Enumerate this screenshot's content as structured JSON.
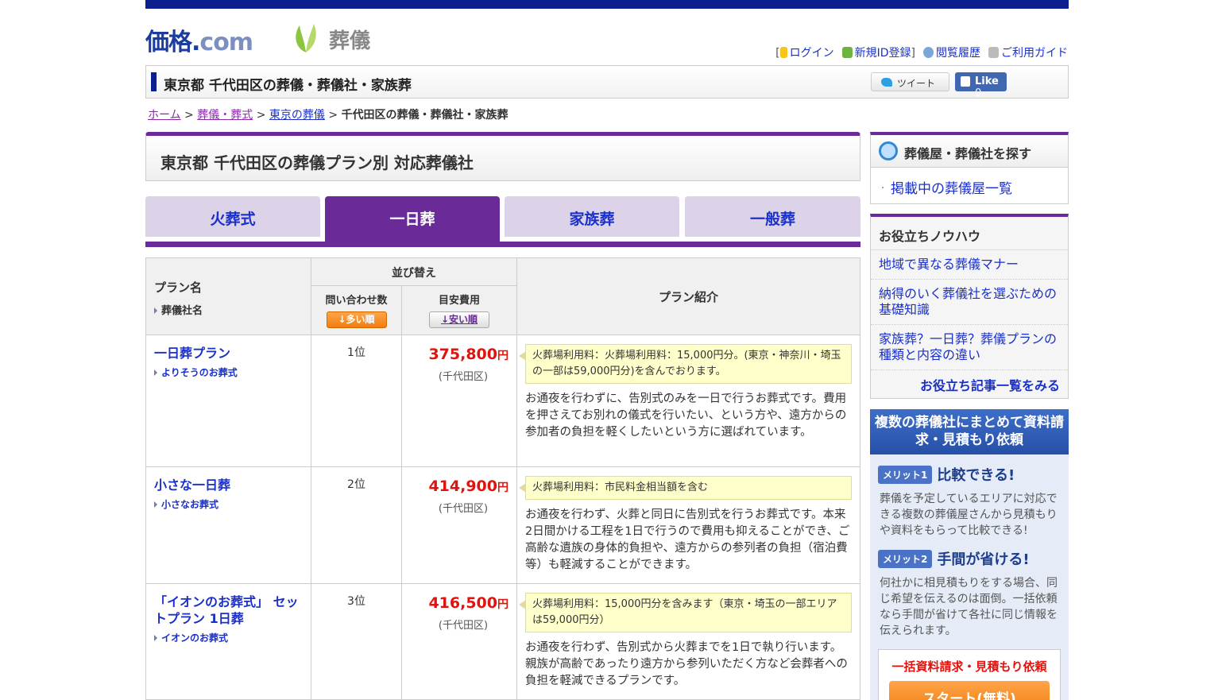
{
  "header": {
    "logo_main": "価格",
    "logo_dot": ".",
    "logo_com": "com",
    "logo_sub": "葬儀",
    "links": {
      "login": "ログイン",
      "register": "新規ID登録",
      "history": "閲覧履歴",
      "guide": "ご利用ガイド"
    }
  },
  "title_bar": {
    "title": "東京都 千代田区の葬儀・葬儀社・家族葬",
    "tweet_label": "ツイート",
    "like_label": "Like",
    "like_count": "0"
  },
  "breadcrumb": {
    "home": "ホーム",
    "sep": ">",
    "funeral": "葬儀・葬式",
    "tokyo": "東京の葬儀",
    "current": "千代田区の葬儀・葬儀社・家族葬"
  },
  "main": {
    "heading": "東京都 千代田区の葬儀プラン別 対応葬儀社",
    "tabs": [
      {
        "label": "火葬式",
        "active": false
      },
      {
        "label": "一日葬",
        "active": true
      },
      {
        "label": "家族葬",
        "active": false
      },
      {
        "label": "一般葬",
        "active": false
      }
    ],
    "table": {
      "col_plan": "プラン名",
      "col_company": "葬儀社名",
      "col_sort": "並び替え",
      "col_inquiries": "問い合わせ数",
      "col_cost": "目安費用",
      "btn_many": "↓多い順",
      "btn_cheap": "↓安い順",
      "col_intro": "プラン紹介",
      "rows": [
        {
          "plan": "一日葬プラン",
          "company": "よりそうのお葬式",
          "rank": "1位",
          "price": "375,800",
          "yen": "円",
          "area": "(千代田区)",
          "note": "火葬場利用料：火葬場利用料：15,000円分。(東京・神奈川・埼玉の一部は59,000円分)を含んでおります。",
          "desc": "お通夜を行わずに、告別式のみを一日で行うお葬式です。費用を押さえてお別れの儀式を行いたい、という方や、遠方からの参加者の負担を軽くしたいという方に選ばれています。"
        },
        {
          "plan": "小さな一日葬",
          "company": "小さなお葬式",
          "rank": "2位",
          "price": "414,900",
          "yen": "円",
          "area": "(千代田区)",
          "note": "火葬場利用料：市民料金相当額を含む",
          "desc": "お通夜を行わず、火葬と同日に告別式を行うお葬式です。本来2日間かける工程を1日で行うので費用も抑えることができ、ご高齢な遺族の身体的負担や、遠方からの参列者の負担（宿泊費等）も軽減することができます。"
        },
        {
          "plan": "「イオンのお葬式」 セットプラン 1日葬",
          "company": "イオンのお葬式",
          "rank": "3位",
          "price": "416,500",
          "yen": "円",
          "area": "(千代田区)",
          "note": "火葬場利用料：15,000円分を含みます（東京・埼玉の一部エリアは59,000円分）",
          "desc": "お通夜を行わず、告別式から火葬までを1日で執り行います。親族が高齢であったり遠方から参列いただく方など会葬者への負担を軽減できるプランです。"
        }
      ]
    }
  },
  "sidebar": {
    "search": {
      "title": "葬儀屋・葬儀社を探す",
      "bullet": "・",
      "item": "掲載中の葬儀屋一覧"
    },
    "knowhow": {
      "title": "お役立ちノウハウ",
      "items": [
        "地域で異なる葬儀マナー",
        "納得のいく葬儀社を選ぶための基礎知識",
        "家族葬？一日葬？葬儀プランの種類と内容の違い"
      ],
      "more": "お役立ち記事一覧をみる"
    },
    "promo": {
      "title": "複数の葬儀社にまとめて資料請求・見積もり依頼",
      "merit1_badge": "メリット1",
      "merit1_title": "比較できる!",
      "merit1_text": "葬儀を予定しているエリアに対応できる複数の葬儀屋さんから見積もりや資料をもらって比較できる!",
      "merit2_badge": "メリット2",
      "merit2_title": "手間が省ける!",
      "merit2_text": "何社かに相見積もりをする場合、同じ希望を伝えるのは面倒。一括依頼なら手間が省けて各社に同じ情報を伝えられます。",
      "box_title": "一括資料請求・見積もり依頼",
      "start_button": "スタート(無料)"
    }
  }
}
